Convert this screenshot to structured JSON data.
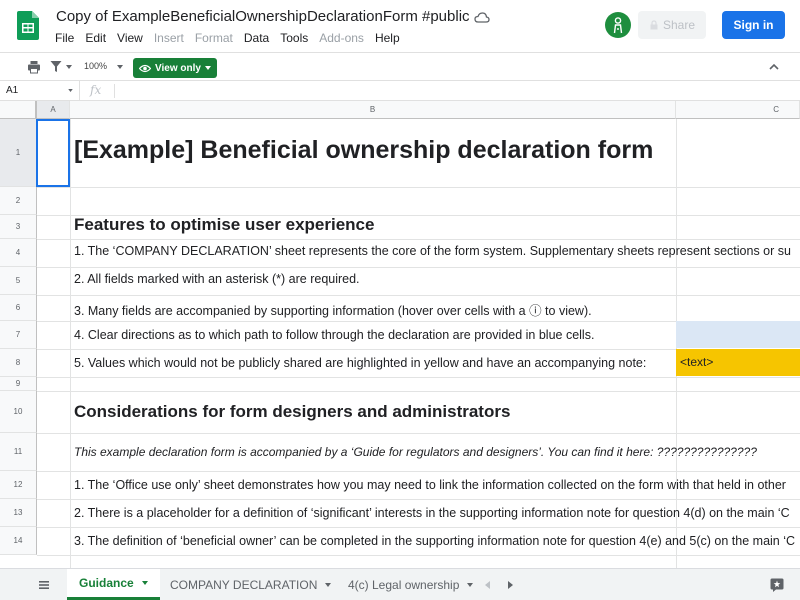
{
  "header": {
    "title": "Copy of ExampleBeneficialOwnershipDeclarationForm #public",
    "menu": [
      {
        "label": "File",
        "disabled": false
      },
      {
        "label": "Edit",
        "disabled": false
      },
      {
        "label": "View",
        "disabled": false
      },
      {
        "label": "Insert",
        "disabled": true
      },
      {
        "label": "Format",
        "disabled": true
      },
      {
        "label": "Data",
        "disabled": false
      },
      {
        "label": "Tools",
        "disabled": false
      },
      {
        "label": "Add-ons",
        "disabled": true
      },
      {
        "label": "Help",
        "disabled": false
      }
    ],
    "share_label": "Share",
    "signin_label": "Sign in"
  },
  "toolbar": {
    "zoom": "100%",
    "view_only_label": "View only"
  },
  "formula_bar": {
    "cell_ref": "A1",
    "fx": "fx"
  },
  "grid": {
    "columns": [
      "A",
      "B",
      "C"
    ],
    "rows": [
      "1",
      "2",
      "3",
      "4",
      "5",
      "6",
      "7",
      "8",
      "9",
      "10",
      "11",
      "12",
      "13",
      "14"
    ],
    "title": "[Example] Beneficial ownership declaration form",
    "heading1": "Features to optimise user experience",
    "item1": "1. The ‘COMPANY DECLARATION’ sheet represents the core of the form system. Supplementary sheets represent sections or su",
    "item2": "2. All fields marked with an asterisk (*) are required.",
    "item3": "3. Many fields are accompanied by supporting information (hover over cells with a ⓘ to view).",
    "item4": "4. Clear directions as to which path to follow through the declaration are provided in blue cells.",
    "item5": "5. Values which would not be publicly shared are highlighted in yellow and have an accompanying note:",
    "yellow_text": "<text>",
    "heading2": "Considerations for form designers and administrators",
    "italic_note": "This example declaration form is accompanied by a ‘Guide for regulators and designers’.  You can find it here: ???????????????",
    "consider1": "1. The ‘Office use only’ sheet demonstrates how you may need to link the information collected on the form with that held in other",
    "consider2": "2. There is a placeholder for a definition of ‘significant’ interests in the supporting information note for question 4(d) on the main ‘C",
    "consider3": "3. The definition of ‘beneficial owner’ can be completed in the supporting information note for question 4(e) and 5(c) on the main ‘C",
    "colors": {
      "blue_cell": "#dbe7f5",
      "yellow_cell": "#f6c500",
      "select": "#1a73e8"
    }
  },
  "sheets": {
    "tabs": [
      "Guidance",
      "COMPANY DECLARATION",
      "4(c) Legal ownership"
    ],
    "active": "Guidance"
  },
  "colors": {
    "brand_green": "#188038",
    "signin_blue": "#1a73e8"
  }
}
